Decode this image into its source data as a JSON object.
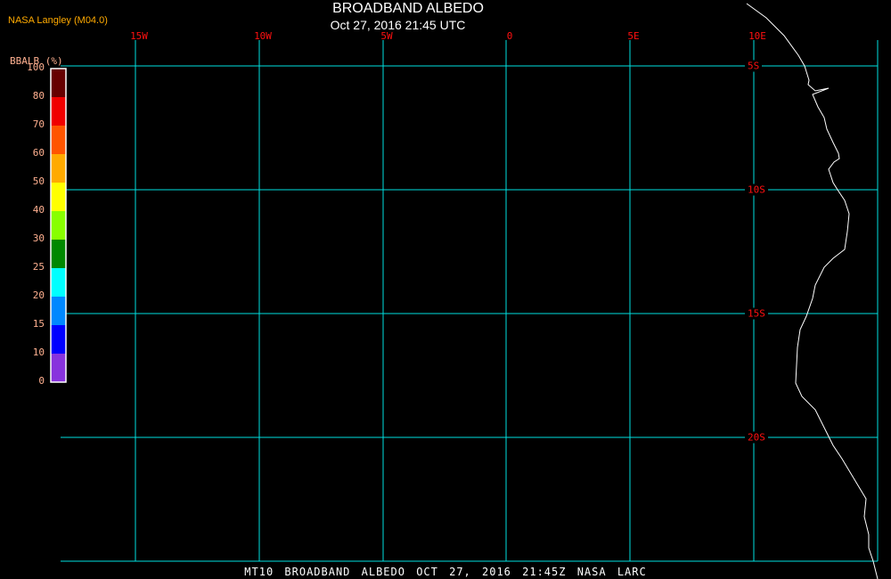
{
  "header": {
    "title": "BROADBAND ALBEDO",
    "subtitle": "Oct 27, 2016 21:45 UTC",
    "organization": "NASA Langley (M04.0)"
  },
  "colorbar": {
    "title": "BBALB (%)",
    "labels": [
      "100",
      "80",
      "70",
      "60",
      "50",
      "40",
      "30",
      "25",
      "20",
      "15",
      "10",
      "0"
    ],
    "colors": [
      "#660000",
      "#f00000",
      "#ff5500",
      "#ffaa00",
      "#ffff00",
      "#88ff00",
      "#008800",
      "#00ffff",
      "#0088ff",
      "#0000ff",
      "#8833dd"
    ]
  },
  "map": {
    "lon_labels": [
      "15W",
      "10W",
      "5W",
      "0",
      "5E",
      "10E"
    ],
    "lat_labels": [
      "5S",
      "10S",
      "15S",
      "20S"
    ],
    "grid_color": "#00e0e0",
    "coast_color": "#ffffff",
    "label_color": "#ff1010"
  },
  "footer": "MT10  BROADBAND ALBEDO  OCT 27, 2016 21:45Z  NASA LARC"
}
